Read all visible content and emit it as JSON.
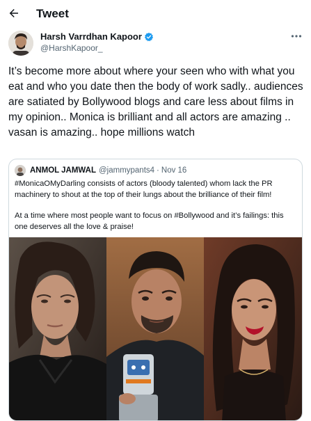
{
  "header": {
    "title": "Tweet",
    "back_icon": "arrow-left-icon"
  },
  "tweet": {
    "author": {
      "name": "Harsh Varrdhan Kapoor",
      "handle": "@HarshKapoor_",
      "verified": true
    },
    "text": "It’s become more about where your seen who with what you eat and who you date then the body of work sadly.. audiences are satiated by Bollywood blogs and care less about films in my opinion.. Monica is brilliant and all actors are amazing .. vasan is amazing.. hope millions watch"
  },
  "quote": {
    "author_name": "ANMOL JAMWAL",
    "handle": "@jammypants4",
    "separator": "·",
    "date": "Nov 16",
    "paragraph_1": "#MonicaOMyDarling consists of actors (bloody talented) whom lack the PR machinery to shout at the top of their lungs about the brilliance of their film!",
    "paragraph_2": "At a time where most people want to focus on #Bollywood and it’s failings: this one deserves all the love & praise!"
  },
  "colors": {
    "text_primary": "#0f1419",
    "text_secondary": "#536471",
    "border": "#cfd9de",
    "verified_blue": "#1d9bf0"
  }
}
